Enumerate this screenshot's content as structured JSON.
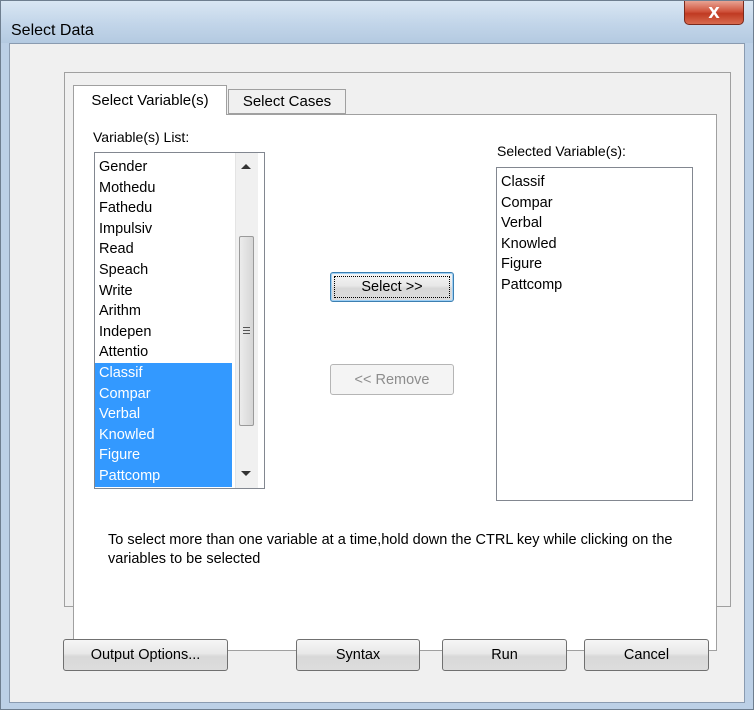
{
  "window": {
    "title": "Select Data",
    "close_glyph": "X"
  },
  "tabs": [
    {
      "label": "Select Variable(s)"
    },
    {
      "label": "Select Cases"
    }
  ],
  "variables_list": {
    "label": "Variable(s) List:",
    "items": [
      "Gender",
      "Mothedu",
      "Fathedu",
      "Impulsiv",
      "Read",
      "Speach",
      "Write",
      "Arithm",
      "Indepen",
      "Attentio",
      "Classif",
      "Compar",
      "Verbal",
      "Knowled",
      "Figure",
      "Pattcomp"
    ],
    "selected": [
      "Classif",
      "Compar",
      "Verbal",
      "Knowled",
      "Figure",
      "Pattcomp"
    ]
  },
  "selected_variables": {
    "label": "Selected Variable(s):",
    "items": [
      "Classif",
      "Compar",
      "Verbal",
      "Knowled",
      "Figure",
      "Pattcomp"
    ]
  },
  "buttons": {
    "select": "Select >>",
    "remove": "<< Remove",
    "output_options": "Output Options...",
    "syntax": "Syntax",
    "run": "Run",
    "cancel": "Cancel"
  },
  "instructions": "To select more than one variable at a time,hold down the CTRL key while clicking on the variables to be selected",
  "colors": {
    "selection": "#3399ff",
    "dialog_bg": "#f0f0f0",
    "close_button": "#c94b33"
  }
}
